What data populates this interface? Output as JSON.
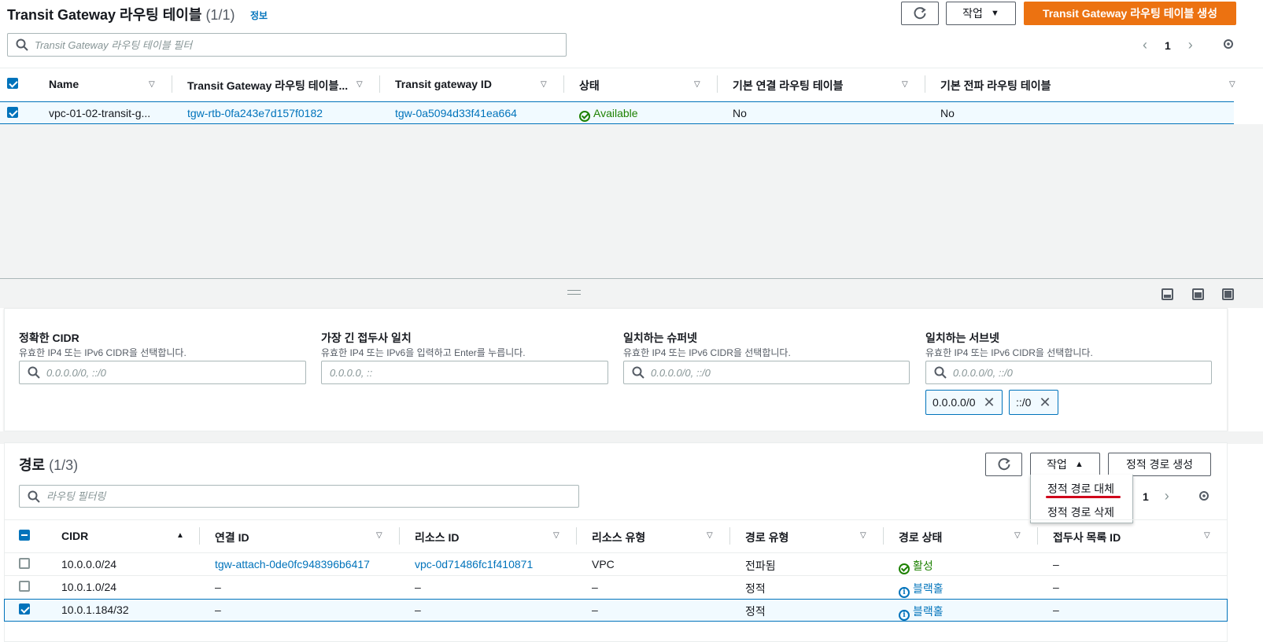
{
  "top": {
    "title": "Transit Gateway 라우팅 테이블",
    "count": "(1/1)",
    "info": "정보",
    "refresh_icon": "refresh-icon",
    "actions_label": "작업",
    "create_label": "Transit Gateway 라우팅 테이블 생성",
    "search_placeholder": "Transit Gateway 라우팅 테이블 필터",
    "page": "1",
    "columns": [
      "Name",
      "Transit Gateway 라우팅 테이블...",
      "Transit gateway ID",
      "상태",
      "기본 연결 라우팅 테이블",
      "기본 전파 라우팅 테이블"
    ],
    "row": {
      "name": "vpc-01-02-transit-g...",
      "rtb_id": "tgw-rtb-0fa243e7d157f0182",
      "tgw_id": "tgw-0a5094d33f41ea664",
      "status": "Available",
      "assoc_default": "No",
      "prop_default": "No"
    }
  },
  "filters": [
    {
      "label": "정확한 CIDR",
      "desc": "유효한 IP4 또는 IPv6 CIDR을 선택합니다.",
      "placeholder": "0.0.0.0/0, ::/0"
    },
    {
      "label": "가장 긴 접두사 일치",
      "desc": "유효한 IP4 또는 IPv6을 입력하고 Enter를 누릅니다.",
      "placeholder": "0.0.0.0, ::"
    },
    {
      "label": "일치하는 슈퍼넷",
      "desc": "유효한 IP4 또는 IPv6 CIDR을 선택합니다.",
      "placeholder": "0.0.0.0/0, ::/0"
    },
    {
      "label": "일치하는 서브넷",
      "desc": "유효한 IP4 또는 IPv6 CIDR을 선택합니다.",
      "placeholder": "0.0.0.0/0, ::/0"
    }
  ],
  "tokens": [
    "0.0.0.0/0",
    "::/0"
  ],
  "routes": {
    "title": "경로",
    "count": "(1/3)",
    "actions_label": "작업",
    "create_label": "정적 경로 생성",
    "search_placeholder": "라우팅 필터링",
    "page": "1",
    "menu": [
      "정적 경로 대체",
      "정적 경로 삭제"
    ],
    "columns": [
      "CIDR",
      "연결 ID",
      "리소스 ID",
      "리소스 유형",
      "경로 유형",
      "경로 상태",
      "접두사 목록 ID"
    ],
    "rows": [
      {
        "cidr": "10.0.0.0/24",
        "attach": "tgw-attach-0de0fc948396b6417",
        "resource": "vpc-0d71486fc1f410871",
        "rtype": "VPC",
        "route_type": "전파됨",
        "state": "활성",
        "prefix": "–"
      },
      {
        "cidr": "10.0.1.0/24",
        "attach": "–",
        "resource": "–",
        "rtype": "–",
        "route_type": "정적",
        "state": "블랙홀",
        "prefix": "–"
      },
      {
        "cidr": "10.0.1.184/32",
        "attach": "–",
        "resource": "–",
        "rtype": "–",
        "route_type": "정적",
        "state": "블랙홀",
        "prefix": "–"
      }
    ]
  }
}
